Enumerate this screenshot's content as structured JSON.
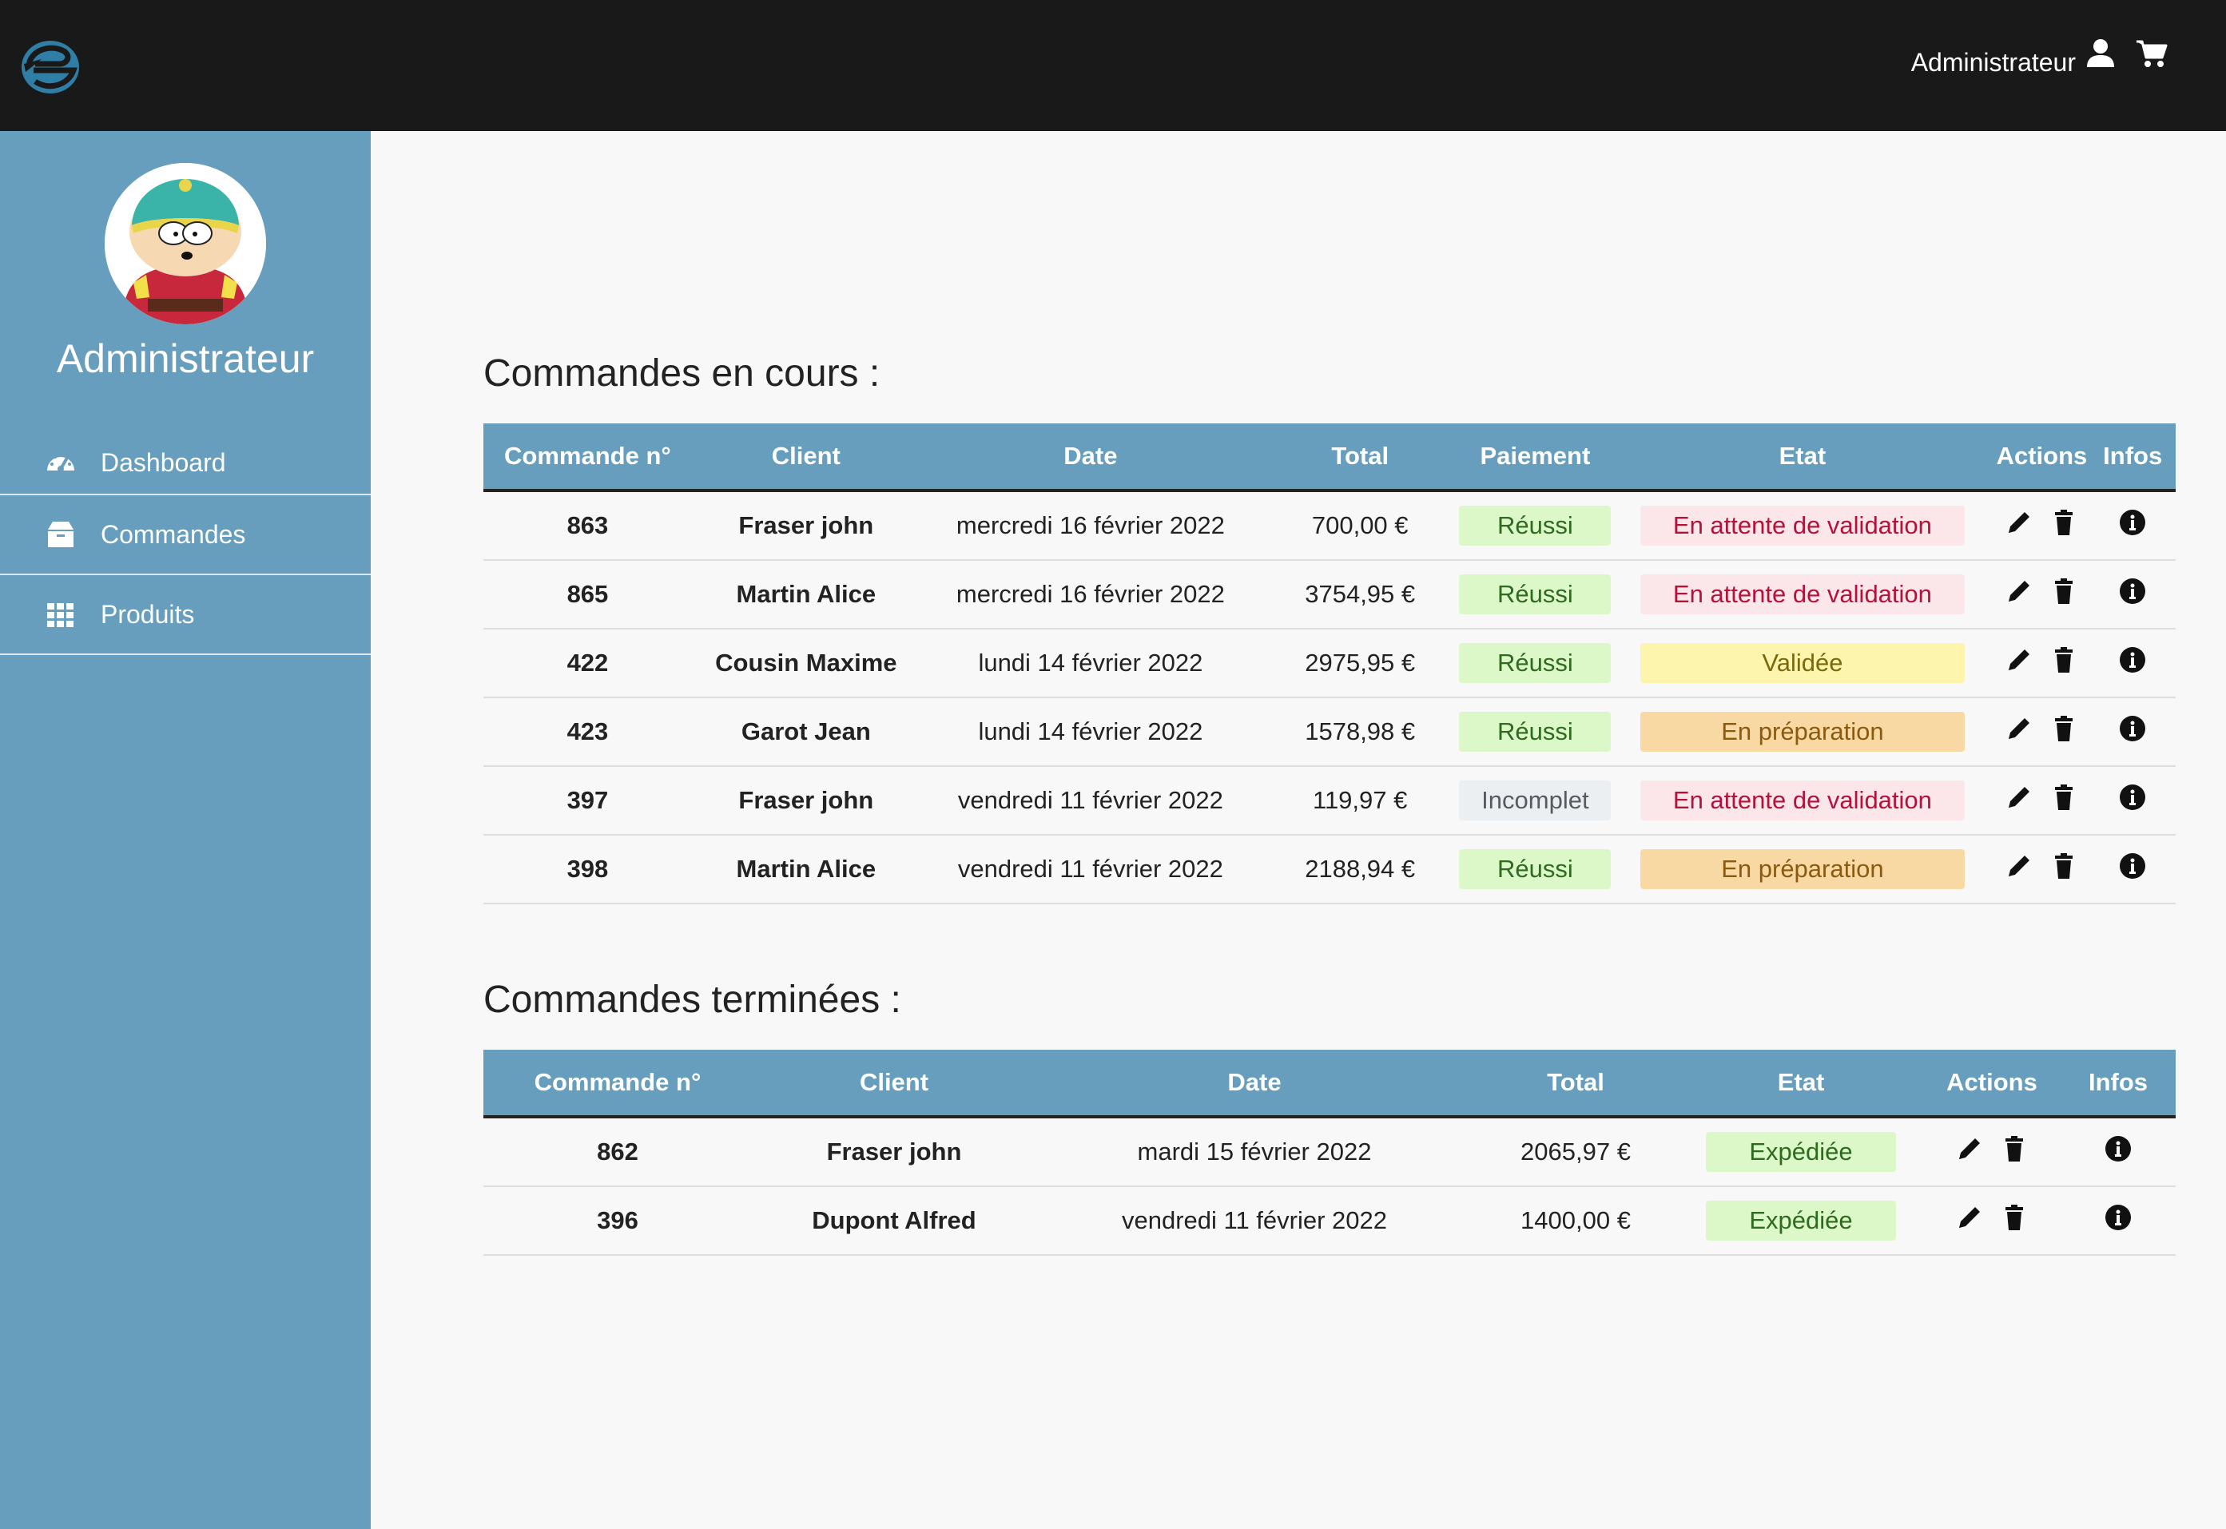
{
  "header": {
    "user_label": "Administrateur",
    "icons": [
      "logo-icon",
      "user-icon",
      "cart-icon"
    ]
  },
  "sidebar": {
    "title": "Administrateur",
    "items": [
      {
        "label": "Dashboard",
        "icon": "gauge-icon"
      },
      {
        "label": "Commandes",
        "icon": "box-icon"
      },
      {
        "label": "Produits",
        "icon": "grid-icon"
      }
    ]
  },
  "colors": {
    "topbar": "#191919",
    "sidebar": "#679ebd",
    "table_header": "#679ebd",
    "success_bg": "#dcf7c8",
    "success_fg": "#2e6b1f",
    "pending_bg": "#fbe6ea",
    "pending_fg": "#b3123a",
    "validated_bg": "#fdf4ae",
    "validated_fg": "#7a6a0c",
    "prep_bg": "#f8d9a3",
    "prep_fg": "#8a5a10",
    "incomplete_bg": "#eceff2",
    "incomplete_fg": "#555b61"
  },
  "current": {
    "title": "Commandes en cours :",
    "headers": [
      "Commande n°",
      "Client",
      "Date",
      "Total",
      "Paiement",
      "Etat",
      "Actions",
      "Infos"
    ],
    "rows": [
      {
        "id": "863",
        "client": "Fraser john",
        "date": "mercredi 16 février 2022",
        "total": "700,00 €",
        "payment": "Réussi",
        "payment_status": "success",
        "state": "En attente de validation",
        "state_status": "pending"
      },
      {
        "id": "865",
        "client": "Martin Alice",
        "date": "mercredi 16 février 2022",
        "total": "3754,95 €",
        "payment": "Réussi",
        "payment_status": "success",
        "state": "En attente de validation",
        "state_status": "pending"
      },
      {
        "id": "422",
        "client": "Cousin Maxime",
        "date": "lundi 14 février 2022",
        "total": "2975,95 €",
        "payment": "Réussi",
        "payment_status": "success",
        "state": "Validée",
        "state_status": "validated"
      },
      {
        "id": "423",
        "client": "Garot Jean",
        "date": "lundi 14 février 2022",
        "total": "1578,98 €",
        "payment": "Réussi",
        "payment_status": "success",
        "state": "En préparation",
        "state_status": "prep"
      },
      {
        "id": "397",
        "client": "Fraser john",
        "date": "vendredi 11 février 2022",
        "total": "119,97 €",
        "payment": "Incomplet",
        "payment_status": "incomplete",
        "state": "En attente de validation",
        "state_status": "pending"
      },
      {
        "id": "398",
        "client": "Martin Alice",
        "date": "vendredi 11 février 2022",
        "total": "2188,94 €",
        "payment": "Réussi",
        "payment_status": "success",
        "state": "En préparation",
        "state_status": "prep"
      }
    ]
  },
  "finished": {
    "title": "Commandes terminées :",
    "headers": [
      "Commande n°",
      "Client",
      "Date",
      "Total",
      "Etat",
      "Actions",
      "Infos"
    ],
    "rows": [
      {
        "id": "862",
        "client": "Fraser john",
        "date": "mardi 15 février 2022",
        "total": "2065,97 €",
        "state": "Expédiée",
        "state_status": "success"
      },
      {
        "id": "396",
        "client": "Dupont Alfred",
        "date": "vendredi 11 février 2022",
        "total": "1400,00 €",
        "state": "Expédiée",
        "state_status": "success"
      }
    ]
  }
}
